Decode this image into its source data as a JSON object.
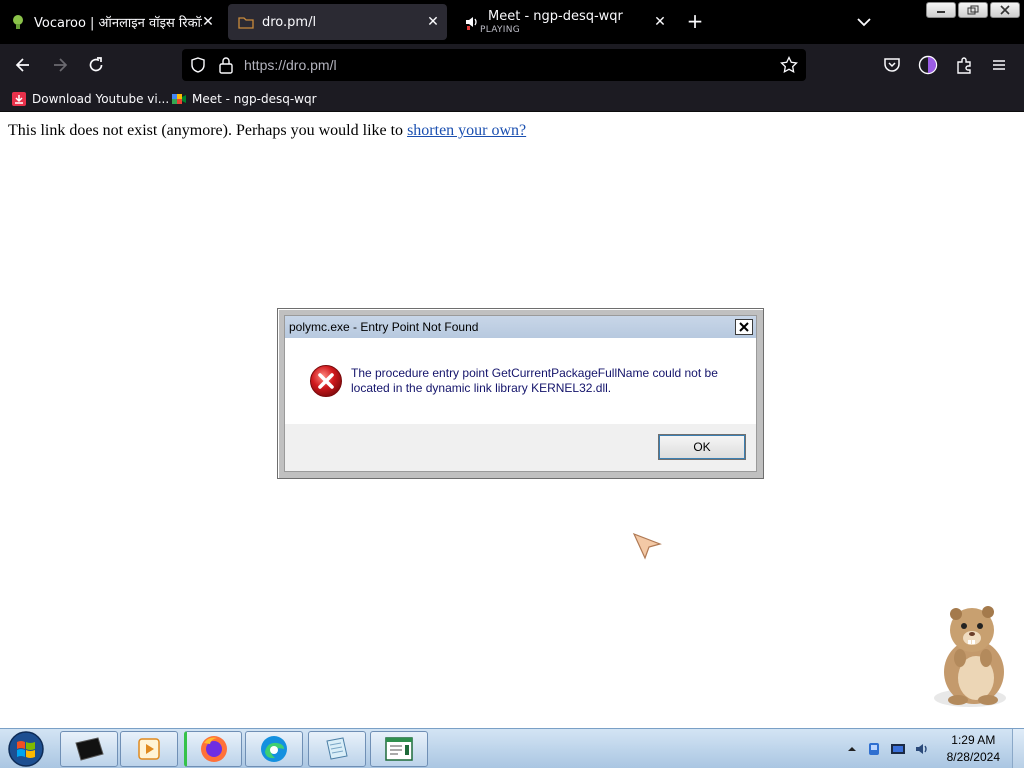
{
  "browser": {
    "tabs": [
      {
        "title": "Vocaroo | ऑनलाइन वॉइस रिकॉर्डर",
        "active": false
      },
      {
        "title": "dro.pm/l",
        "active": true
      },
      {
        "title": "Meet - ngp-desq-wqr",
        "subtitle": "PLAYING",
        "active": false
      }
    ],
    "url": "https://dro.pm/l",
    "bookmarks": [
      {
        "label": "Download Youtube vi..."
      },
      {
        "label": "Meet - ngp-desq-wqr"
      }
    ]
  },
  "page": {
    "message": "This link does not exist (anymore). Perhaps you would like to ",
    "link_text": "shorten your own?"
  },
  "dialog": {
    "title": "polymc.exe - Entry Point Not Found",
    "body": "The procedure entry point GetCurrentPackageFullName could not be located in the dynamic link library KERNEL32.dll.",
    "ok_label": "OK",
    "close_glyph": "✕",
    "icon": "error-icon"
  },
  "taskbar": {
    "apps": [
      "terminal-icon",
      "media-player-icon",
      "firefox-icon",
      "edge-icon",
      "notepad-icon",
      "window-app-icon"
    ],
    "time": "1:29 AM",
    "date": "8/28/2024"
  },
  "colors": {
    "tab_strip": "#000000",
    "nav_bar": "#1c1b22",
    "link": "#1a4fb0",
    "dialog_title": "#b7c9df",
    "error_red": "#d0191d"
  }
}
